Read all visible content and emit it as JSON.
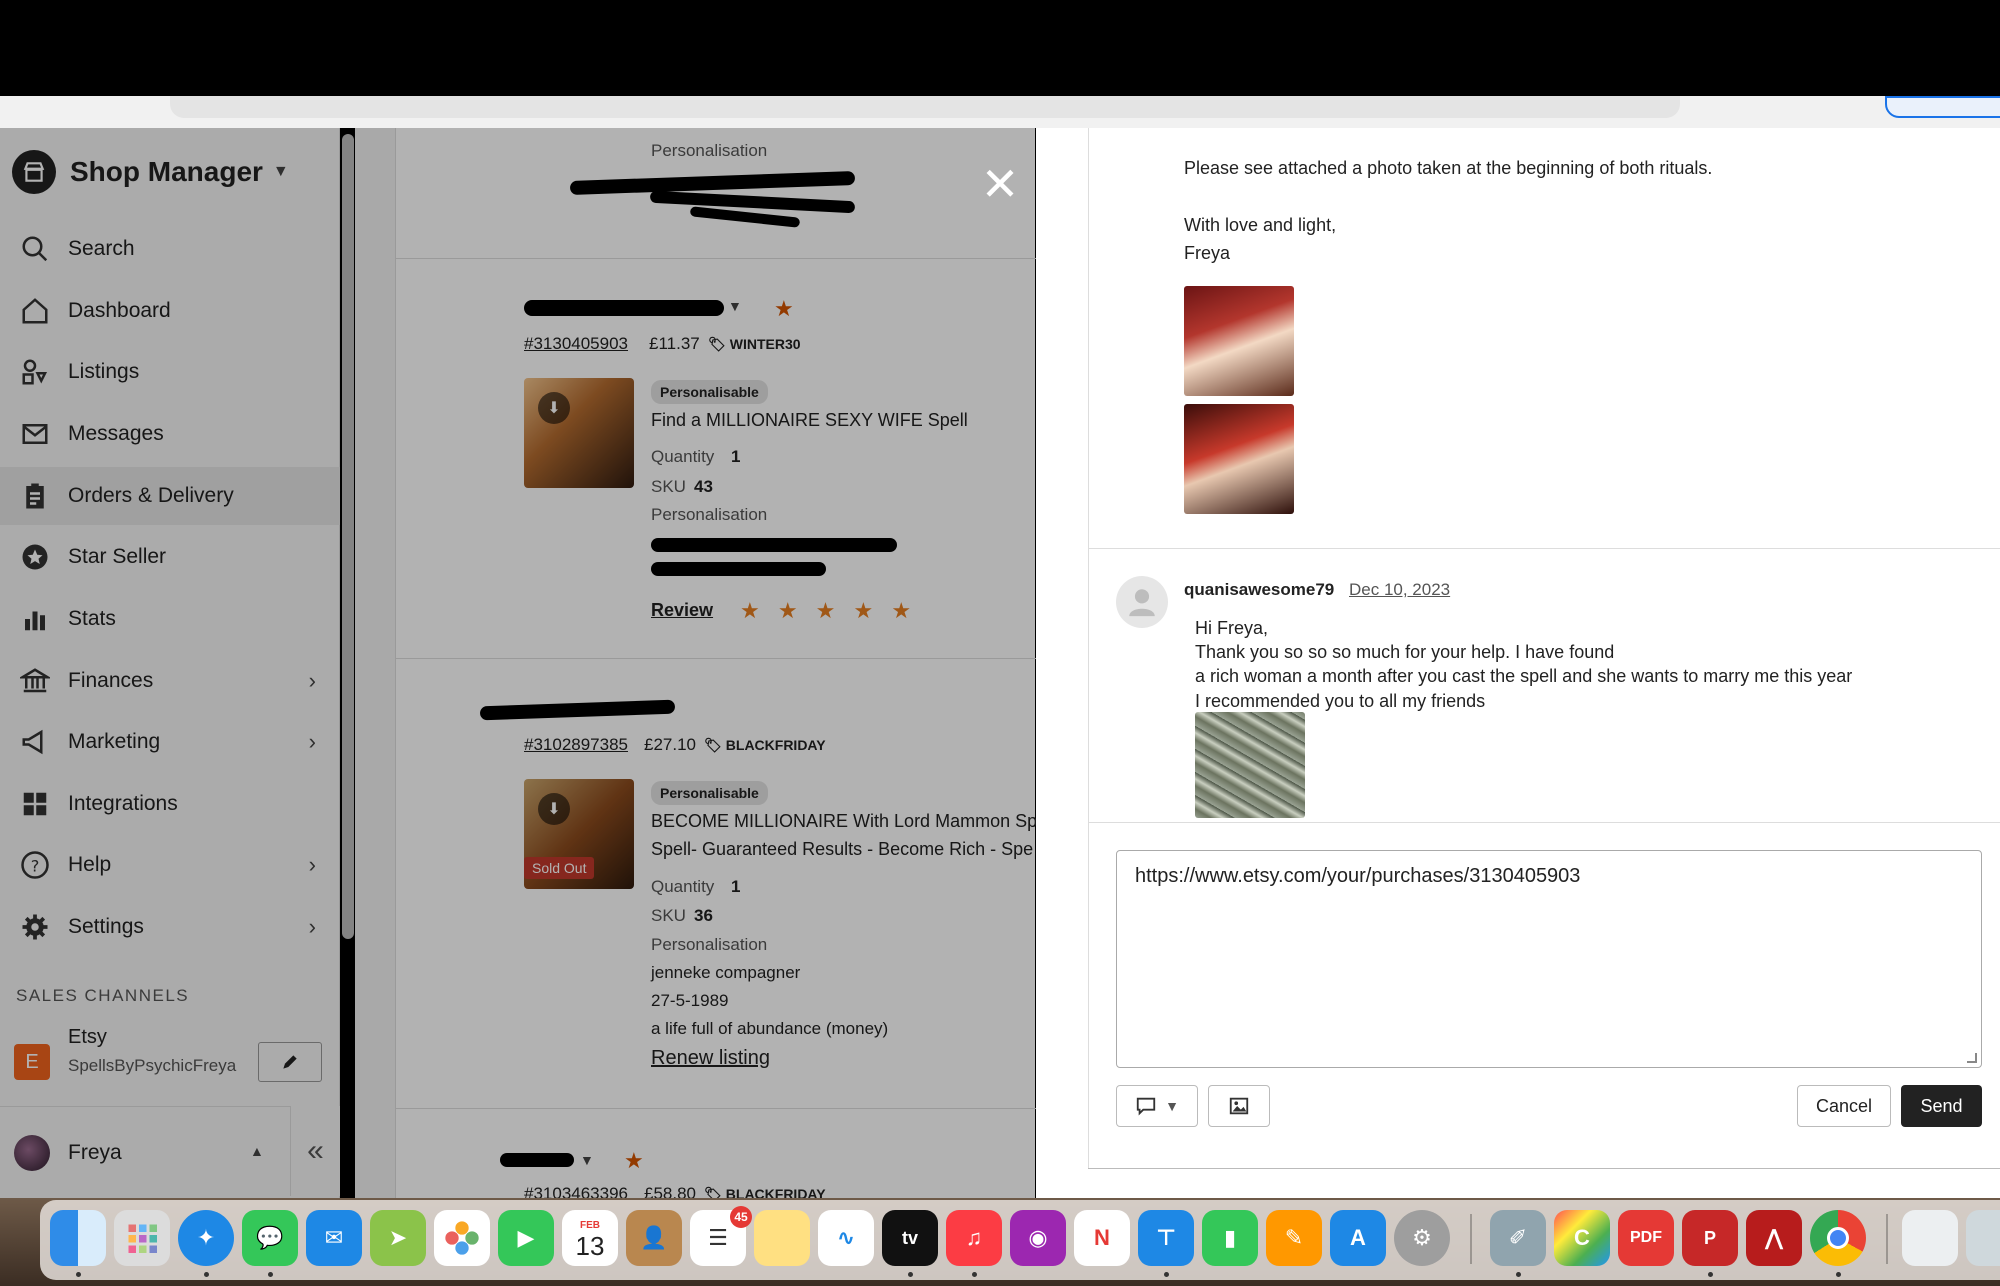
{
  "sidebar": {
    "brand": "Shop Manager",
    "items": [
      {
        "label": "Search",
        "icon": "search-icon"
      },
      {
        "label": "Dashboard",
        "icon": "home-icon"
      },
      {
        "label": "Listings",
        "icon": "shapes-icon"
      },
      {
        "label": "Messages",
        "icon": "envelope-icon"
      },
      {
        "label": "Orders & Delivery",
        "icon": "clipboard-icon",
        "active": true
      },
      {
        "label": "Star Seller",
        "icon": "star-badge-icon"
      },
      {
        "label": "Stats",
        "icon": "bar-chart-icon"
      },
      {
        "label": "Finances",
        "icon": "bank-icon",
        "has_submenu": true
      },
      {
        "label": "Marketing",
        "icon": "megaphone-icon",
        "has_submenu": true
      },
      {
        "label": "Integrations",
        "icon": "grid-icon"
      },
      {
        "label": "Help",
        "icon": "question-icon",
        "has_submenu": true
      },
      {
        "label": "Settings",
        "icon": "gear-icon",
        "has_submenu": true
      }
    ],
    "sales_channels_title": "SALES CHANNELS",
    "channel": {
      "logo": "E",
      "name": "Etsy",
      "shop": "SpellsByPsychicFreya"
    },
    "user": "Freya"
  },
  "orders": {
    "top_label": "Personalisation",
    "order1": {
      "number": "#3130405903",
      "price": "£11.37",
      "coupon": "WINTER30",
      "badge": "Personalisable",
      "title": "Find a MILLIONAIRE SEXY WIFE Spell",
      "quantity_label": "Quantity",
      "quantity": "1",
      "sku_label": "SKU",
      "sku": "43",
      "personalisation_label": "Personalisation",
      "review_label": "Review",
      "rating": "★ ★ ★ ★ ★"
    },
    "order2": {
      "number": "#3102897385",
      "price": "£27.10",
      "coupon": "BLACKFRIDAY",
      "badge": "Personalisable",
      "sold_out": "Sold Out",
      "title_line1": "BECOME MILLIONAIRE With Lord Mammon Spe",
      "title_line2": "Spell- Guaranteed Results - Become Rich - Spe",
      "quantity_label": "Quantity",
      "quantity": "1",
      "sku_label": "SKU",
      "sku": "36",
      "personalisation_label": "Personalisation",
      "personalisation_lines": [
        "jenneke compagner",
        "27-5-1989",
        "a life full of abundance (money)"
      ],
      "renew_label": "Renew listing"
    },
    "order3": {
      "number": "#3103463396",
      "price": "£58.80",
      "coupon": "BLACKFRIDAY"
    }
  },
  "messages": {
    "seller_msg": [
      "Please see attached a photo taken at the beginning of both rituals.",
      "With love and light,",
      "Freya"
    ],
    "buyer": {
      "name": "quanisawesome79",
      "date": "Dec 10, 2023",
      "lines": [
        "Hi Freya,",
        "Thank you so so so much for your help. I have found",
        "a rich woman a month after you cast the spell and she wants to marry me this year",
        "I recommended you to all my friends"
      ]
    },
    "reply_value": "https://www.etsy.com/your/purchases/3130405903",
    "cancel_label": "Cancel",
    "send_label": "Send"
  },
  "dock": {
    "calendar_month": "FEB",
    "calendar_day": "13",
    "reminders_badge": "45"
  }
}
